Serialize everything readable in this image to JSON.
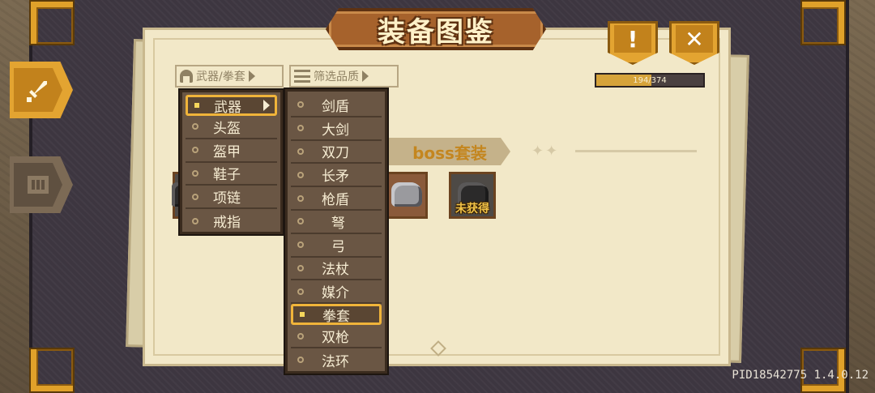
{
  "title": "装备图鉴",
  "top_buttons": {
    "help_label": "!",
    "close_label": "✕"
  },
  "progress": {
    "text": "194/374",
    "current": 194,
    "total": 374
  },
  "filters": {
    "type_label": "武器/拳套",
    "quality_label": "筛选品质"
  },
  "category_menu": {
    "items": [
      "武器",
      "头盔",
      "盔甲",
      "鞋子",
      "项链",
      "戒指"
    ],
    "selected": "武器"
  },
  "subtype_menu": {
    "items": [
      "剑盾",
      "大剑",
      "双刀",
      "长矛",
      "枪盾",
      "弩",
      "弓",
      "法杖",
      "媒介",
      "拳套",
      "双枪",
      "法环"
    ],
    "selected": "拳套"
  },
  "section": {
    "title": "boss套装"
  },
  "items": [
    {
      "name": "boss-gauntlet-partial"
    },
    {
      "name": "gauntlet-obtained"
    },
    {
      "name": "gauntlet-locked",
      "label": "未获得"
    }
  ],
  "side_tabs": {
    "active_icon": "sword-icon",
    "inactive_icon": "bars-icon"
  },
  "version": "PID18542775 1.4.0.12",
  "colors": {
    "gold": "#e3a431",
    "paper": "#f2e8c8",
    "menu": "#6a5644",
    "accent_selected": "#f0b43a"
  }
}
